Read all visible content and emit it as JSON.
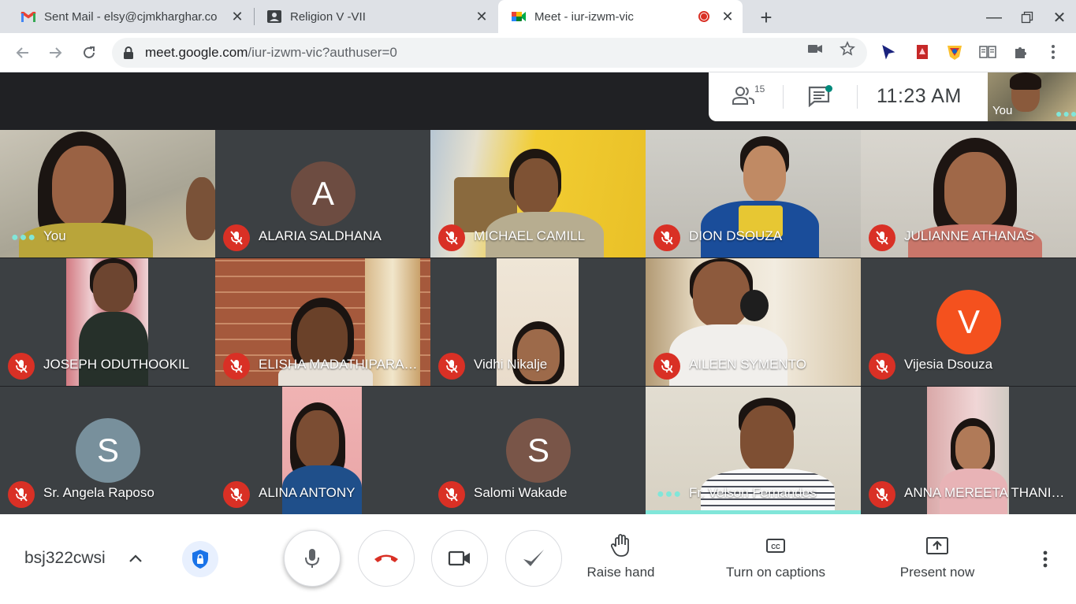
{
  "browser": {
    "tabs": [
      {
        "title": "Sent Mail - elsy@cjmkharghar.co",
        "icon": "gmail-icon"
      },
      {
        "title": "Religion V -VII",
        "icon": "classroom-icon"
      },
      {
        "title": "Meet - iur-izwm-vic",
        "icon": "meet-icon",
        "recording": true
      }
    ],
    "url_host": "meet.google.com",
    "url_path": "/iur-izwm-vic?authuser=0"
  },
  "meet": {
    "participant_count": "15",
    "time": "11:23  AM",
    "self_label": "You",
    "tiles": [
      {
        "name": "You",
        "muted": false,
        "speaking_dots": true
      },
      {
        "name": "ALARIA SALDHANA",
        "muted": true,
        "initial": "A",
        "avatar_color": "#6d4c41"
      },
      {
        "name": "MICHAEL CAMILL",
        "muted": true
      },
      {
        "name": "DION DSOUZA",
        "muted": true
      },
      {
        "name": "JULIANNE ATHANAS",
        "muted": true
      },
      {
        "name": "JOSEPH ODUTHOOKIL",
        "muted": true
      },
      {
        "name": "ELISHA MADATHIPARAMBIL",
        "muted": true
      },
      {
        "name": "Vidhi Nikalje",
        "muted": true
      },
      {
        "name": "AILEEN SYMENTO",
        "muted": true
      },
      {
        "name": "Vijesia Dsouza",
        "muted": true,
        "initial": "V",
        "avatar_color": "#f4511e"
      },
      {
        "name": "Sr. Angela Raposo",
        "muted": true,
        "initial": "S",
        "avatar_color": "#78909c"
      },
      {
        "name": "ALINA ANTONY",
        "muted": true
      },
      {
        "name": "Salomi Wakade",
        "muted": true,
        "initial": "S",
        "avatar_color": "#795548"
      },
      {
        "name": "Fr. Velson Fernandes",
        "muted": false,
        "speaking_dots": true,
        "active_speaker": true
      },
      {
        "name": "ANNA MEREETA THANIKKAL",
        "muted": true
      }
    ]
  },
  "controls": {
    "meeting_code": "bsj322cwsi",
    "raise_hand": "Raise hand",
    "captions": "Turn on captions",
    "present": "Present now"
  },
  "colors": {
    "mute_red": "#d93025",
    "speaking_teal": "#81e6d9",
    "meet_bg": "#202124"
  }
}
